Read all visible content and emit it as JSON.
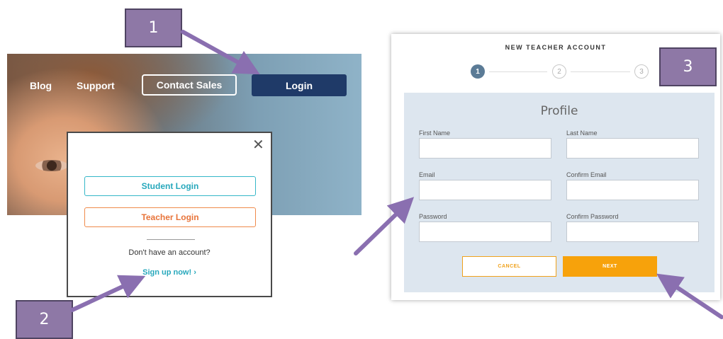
{
  "nav": {
    "blog": "Blog",
    "support": "Support",
    "contact_sales": "Contact Sales",
    "login": "Login"
  },
  "popup": {
    "close_icon": "close-icon",
    "student_login": "Student Login",
    "teacher_login": "Teacher Login",
    "no_account": "Don't have an account?",
    "sign_up": "Sign up now! ›"
  },
  "form": {
    "title": "NEW TEACHER ACCOUNT",
    "steps": [
      "1",
      "2",
      "3"
    ],
    "heading": "Profile",
    "fields": {
      "first_name": {
        "label": "First Name",
        "value": ""
      },
      "last_name": {
        "label": "Last Name",
        "value": ""
      },
      "email": {
        "label": "Email",
        "value": ""
      },
      "confirm_email": {
        "label": "Confirm Email",
        "value": ""
      },
      "password": {
        "label": "Password",
        "value": ""
      },
      "confirm_password": {
        "label": "Confirm Password",
        "value": ""
      }
    },
    "cancel": "CANCEL",
    "next": "NEXT"
  },
  "callouts": [
    "1",
    "2",
    "3"
  ],
  "colors": {
    "nav_login_bg": "#1f3a68",
    "student_accent": "#27a8bc",
    "teacher_accent": "#e8743a",
    "form_card_bg": "#dde6ef",
    "next_bg": "#f7a20b",
    "step_active": "#5b7b96",
    "callout_bg": "#8e78a6",
    "arrow": "#8a6fb0"
  }
}
